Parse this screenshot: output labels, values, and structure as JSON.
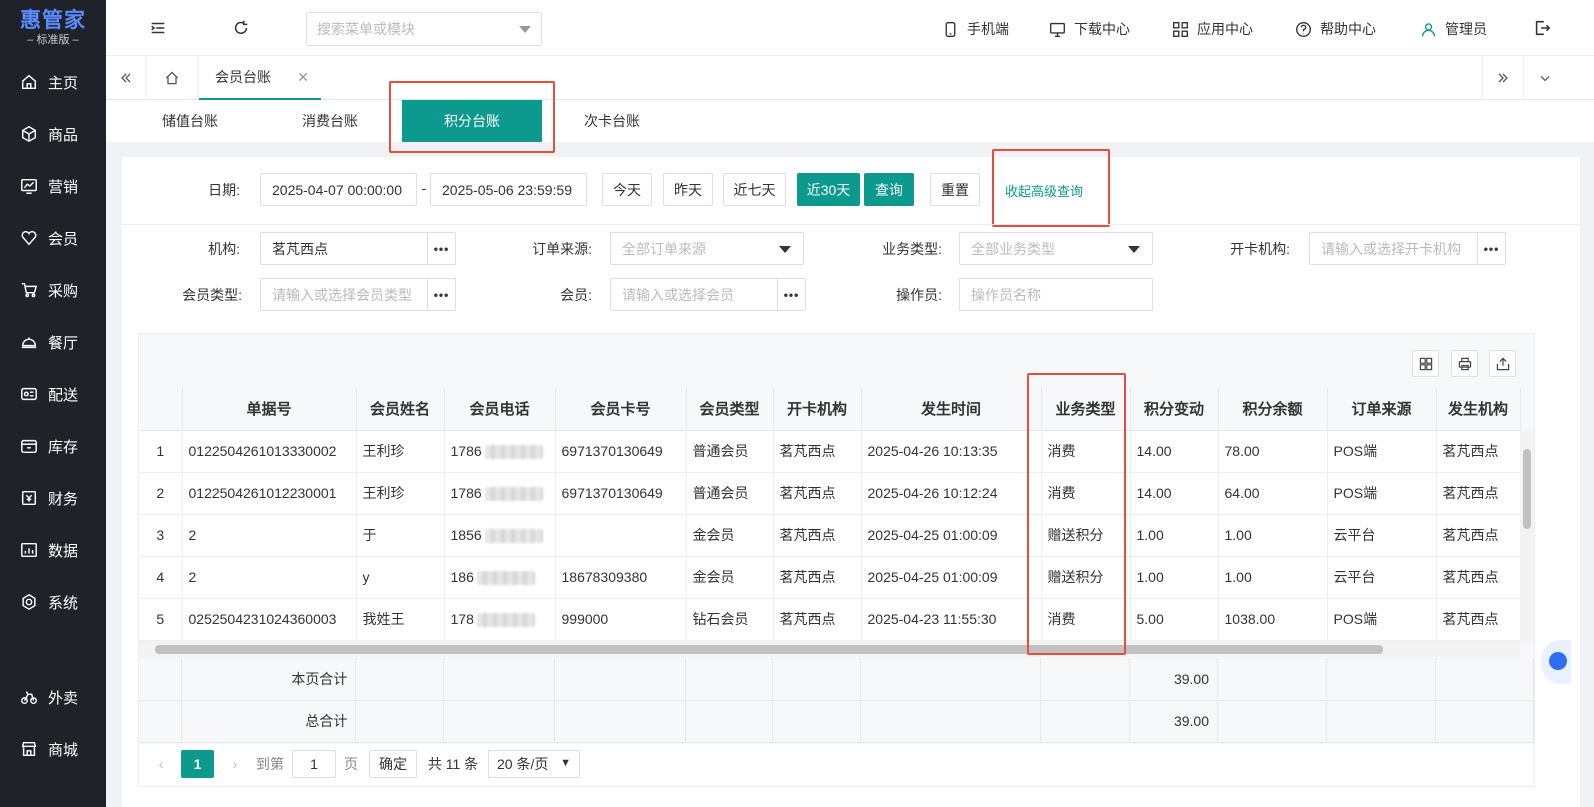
{
  "app": {
    "logo": "惠管家",
    "edition": "– 标准版 –"
  },
  "sidebar": {
    "items": [
      {
        "label": "主页",
        "icon": "home-icon"
      },
      {
        "label": "商品",
        "icon": "box-icon"
      },
      {
        "label": "营销",
        "icon": "chart-icon"
      },
      {
        "label": "会员",
        "icon": "heart-icon"
      },
      {
        "label": "采购",
        "icon": "cart-icon"
      },
      {
        "label": "餐厅",
        "icon": "dish-icon"
      },
      {
        "label": "配送",
        "icon": "truck-icon"
      },
      {
        "label": "库存",
        "icon": "store-icon"
      },
      {
        "label": "财务",
        "icon": "finance-icon"
      },
      {
        "label": "数据",
        "icon": "data-icon"
      },
      {
        "label": "系统",
        "icon": "settings-icon"
      },
      {
        "label": "外卖",
        "icon": "bike-icon"
      },
      {
        "label": "商城",
        "icon": "shop-icon"
      }
    ]
  },
  "header": {
    "search_placeholder": "搜索菜单或模块",
    "links": {
      "mobile": "手机端",
      "download": "下载中心",
      "apps": "应用中心",
      "help": "帮助中心",
      "user": "管理员"
    }
  },
  "tabs": {
    "page_tab": "会员台账"
  },
  "subtabs": [
    "储值台账",
    "消费台账",
    "积分台账",
    "次卡台账"
  ],
  "filters": {
    "date_label": "日期:",
    "date_start": "2025-04-07 00:00:00",
    "date_sep": "-",
    "date_end": "2025-05-06 23:59:59",
    "quick": {
      "today": "今天",
      "yesterday": "昨天",
      "week": "近七天",
      "month": "近30天"
    },
    "query": "查询",
    "reset": "重置",
    "collapse": "收起高级查询",
    "org_label": "机构:",
    "org_value": "茗芃西点",
    "source_label": "订单来源:",
    "source_placeholder": "全部订单来源",
    "btype_label": "业务类型:",
    "btype_placeholder": "全部业务类型",
    "cardorg_label": "开卡机构:",
    "cardorg_placeholder": "请输入或选择开卡机构",
    "mtype_label": "会员类型:",
    "mtype_placeholder": "请输入或选择会员类型",
    "member_label": "会员:",
    "member_placeholder": "请输入或选择会员",
    "operator_label": "操作员:",
    "operator_placeholder": "操作员名称",
    "more": "•••"
  },
  "table": {
    "columns": [
      "",
      "单据号",
      "会员姓名",
      "会员电话",
      "会员卡号",
      "会员类型",
      "开卡机构",
      "发生时间",
      "业务类型",
      "积分变动",
      "积分余额",
      "订单来源",
      "发生机构"
    ],
    "rows": [
      {
        "idx": "1",
        "no": "0122504261013330002",
        "name": "王利珍",
        "phone": "1786",
        "card": "6971370130649",
        "mtype": "普通会员",
        "org": "茗芃西点",
        "time": "2025-04-26 10:13:35",
        "btype": "消费",
        "change": "14.00",
        "balance": "78.00",
        "source": "POS端",
        "occur": "茗芃西点"
      },
      {
        "idx": "2",
        "no": "0122504261012230001",
        "name": "王利珍",
        "phone": "1786",
        "card": "6971370130649",
        "mtype": "普通会员",
        "org": "茗芃西点",
        "time": "2025-04-26 10:12:24",
        "btype": "消费",
        "change": "14.00",
        "balance": "64.00",
        "source": "POS端",
        "occur": "茗芃西点"
      },
      {
        "idx": "3",
        "no": "2",
        "name": "于",
        "phone": "1856",
        "card": "",
        "mtype": "金会员",
        "org": "茗芃西点",
        "time": "2025-04-25 01:00:09",
        "btype": "赠送积分",
        "change": "1.00",
        "balance": "1.00",
        "source": "云平台",
        "occur": "茗芃西点"
      },
      {
        "idx": "4",
        "no": "2",
        "name": "y",
        "phone": "186",
        "card": "18678309380",
        "mtype": "金会员",
        "org": "茗芃西点",
        "time": "2025-04-25 01:00:09",
        "btype": "赠送积分",
        "change": "1.00",
        "balance": "1.00",
        "source": "云平台",
        "occur": "茗芃西点"
      },
      {
        "idx": "5",
        "no": "0252504231024360003",
        "name": "我姓王",
        "phone": "178",
        "card": "999000",
        "mtype": "钻石会员",
        "org": "茗芃西点",
        "time": "2025-04-23 11:55:30",
        "btype": "消费",
        "change": "5.00",
        "balance": "1038.00",
        "source": "POS端",
        "occur": "茗芃西点"
      }
    ],
    "page_total_label": "本页合计",
    "page_total_value": "39.00",
    "grand_total_label": "总合计",
    "grand_total_value": "39.00"
  },
  "pagination": {
    "current": "1",
    "goto_label": "到第",
    "goto_value": "1",
    "page_unit": "页",
    "confirm": "确定",
    "total": "共 11 条",
    "page_size": "20 条/页"
  }
}
